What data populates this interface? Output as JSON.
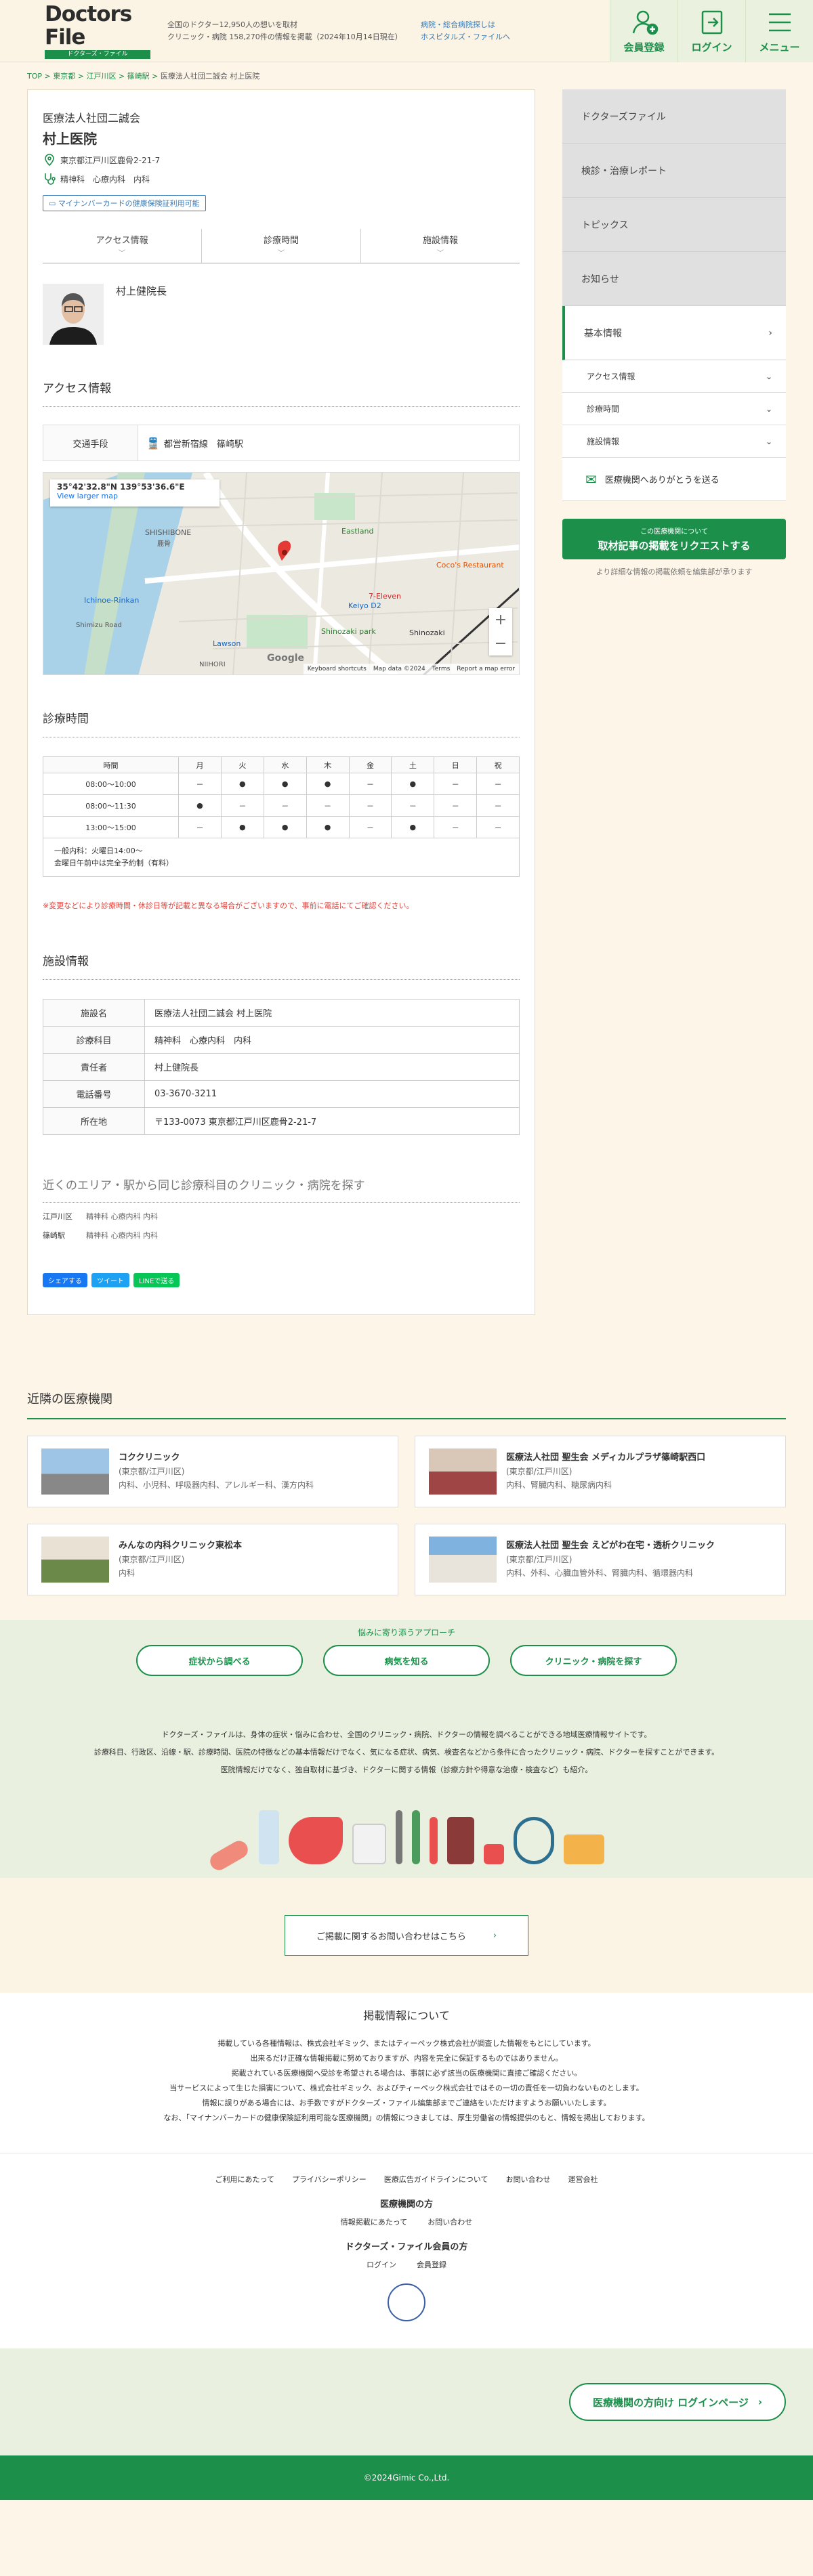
{
  "header": {
    "logo": "Doctors File",
    "logo_sub": "ドクターズ・ファイル",
    "desc1": "全国のドクター12,950人の想いを取材",
    "desc2": "クリニック・病院 158,270件の情報を掲載（2024年10月14日現在）",
    "hosp1": "病院・総合病院探しは",
    "hosp2": "ホスピタルズ・ファイルへ",
    "btn_register": "会員登録",
    "btn_login": "ログイン",
    "btn_menu": "メニュー"
  },
  "breadcrumb": [
    "TOP",
    "東京都",
    "江戸川区",
    "篠崎駅",
    "医療法人社団二誠会 村上医院"
  ],
  "clinic": {
    "corp": "医療法人社団二誠会",
    "name": "村上医院",
    "address": "東京都江戸川区鹿骨2-21-7",
    "depts": "精神科　心療内科　内科",
    "myna": "マイナンバーカードの健康保険証利用可能",
    "tabs": [
      "アクセス情報",
      "診療時間",
      "施設情報"
    ],
    "doctor": "村上健院長"
  },
  "access": {
    "title": "アクセス情報",
    "k": "交通手段",
    "v": "都営新宿線　篠崎駅",
    "map_coord": "35°42'32.8\"N 139°53'36.6\"E",
    "map_link": "View larger map",
    "map_footer": [
      "Keyboard shortcuts",
      "Map data ©2024",
      "Terms",
      "Report a map error"
    ],
    "map_labels": [
      "SHISHIBONE",
      "鹿骨",
      "Eastland",
      "Ichinoe-Rinkan",
      "Shimizu Road",
      "NIIHORI",
      "Lawson",
      "Keiyo D2",
      "7-Eleven",
      "Coco's Restaurant",
      "Shinozaki park",
      "Shinozaki",
      "Google"
    ]
  },
  "hours": {
    "title": "診療時間",
    "cols": [
      "時間",
      "月",
      "火",
      "水",
      "木",
      "金",
      "土",
      "日",
      "祝"
    ],
    "rows": [
      [
        "08:00〜10:00",
        "－",
        "●",
        "●",
        "●",
        "－",
        "●",
        "－",
        "－"
      ],
      [
        "08:00〜11:30",
        "●",
        "－",
        "－",
        "－",
        "－",
        "－",
        "－",
        "－"
      ],
      [
        "13:00〜15:00",
        "－",
        "●",
        "●",
        "●",
        "－",
        "●",
        "－",
        "－"
      ]
    ],
    "note1": "一般内科：火曜日14:00〜",
    "note2": "金曜日午前中は完全予約制（有料）",
    "warn": "※変更などにより診療時間・休診日等が記載と異なる場合がございますので、事前に電話にてご確認ください。"
  },
  "facility": {
    "title": "施設情報",
    "rows": [
      [
        "施設名",
        "医療法人社団二誠会 村上医院"
      ],
      [
        "診療科目",
        "精神科　心療内科　内科"
      ],
      [
        "責任者",
        "村上健院長"
      ],
      [
        "電話番号",
        "03-3670-3211"
      ],
      [
        "所在地",
        "〒133-0073 東京都江戸川区鹿骨2-21-7"
      ]
    ]
  },
  "near": {
    "title": "近くのエリア・駅から同じ診療科目のクリニック・病院を探す",
    "rows": [
      [
        "江戸川区",
        "精神科 心療内科 内科"
      ],
      [
        "篠崎駅",
        "精神科 心療内科 内科"
      ]
    ]
  },
  "share": [
    "シェアする",
    "ツイート",
    "LINEで送る"
  ],
  "side": {
    "nav": [
      "ドクターズファイル",
      "検診・治療レポート",
      "トピックス",
      "お知らせ",
      "基本情報"
    ],
    "sub": [
      "アクセス情報",
      "診療時間",
      "施設情報"
    ],
    "ask": "医療機関へありがとうを送る",
    "req_small": "この医療機関について",
    "req_big": "取材記事の掲載をリクエストする",
    "req_note": "より詳細な情報の掲載依頼を編集部が承ります"
  },
  "nearby": {
    "title": "近隣の医療機関",
    "cards": [
      {
        "name": "コククリニック",
        "area": "(東京都/江戸川区)",
        "depts": "内科、小児科、呼吸器内科、アレルギー科、漢方内科"
      },
      {
        "name": "医療法人社団 聖生会 メディカルプラザ篠崎駅西口",
        "area": "(東京都/江戸川区)",
        "depts": "内科、腎臓内科、糖尿病内科"
      },
      {
        "name": "みんなの内科クリニック東松本",
        "area": "(東京都/江戸川区)",
        "depts": "内科"
      },
      {
        "name": "医療法人社団 聖生会 えどがわ在宅・透析クリニック",
        "area": "(東京都/江戸川区)",
        "depts": "内科、外科、心臓血管外科、腎臓内科、循環器内科"
      }
    ]
  },
  "approach": {
    "q": "悩みに寄り添うアプローチ",
    "btns": [
      "症状から調べる",
      "病気を知る",
      "クリニック・病院を探す"
    ],
    "about1": "ドクターズ・ファイルは、身体の症状・悩みに合わせ、全国のクリニック・病院、ドクターの情報を調べることができる地域医療情報サイトです。",
    "about2": "診療科目、行政区、沿線・駅、診療時間、医院の特徴などの基本情報だけでなく、気になる症状、病気、検査名などから条件に合ったクリニック・病院、ドクターを探すことができます。",
    "about3": "医院情報だけでなく、独自取材に基づき、ドクターに関する情報（診療方針や得意な治療・検査など）も紹介。"
  },
  "inquiry": "ご掲載に関するお問い合わせはこちら",
  "publish": {
    "title": "掲載情報について",
    "lines": [
      "掲載している各種情報は、株式会社ギミック、またはティーペック株式会社が調査した情報をもとにしています。",
      "出来るだけ正確な情報掲載に努めておりますが、内容を完全に保証するものではありません。",
      "掲載されている医療機関へ受診を希望される場合は、事前に必ず該当の医療機関に直接ご確認ください。",
      "当サービスによって生じた損害について、株式会社ギミック、およびティーペック株式会社ではその一切の責任を一切負わないものとします。",
      "情報に誤りがある場合には、お手数ですがドクターズ・ファイル編集部までご連絡をいただけますようお願いいたします。",
      "なお、「マイナンバーカードの健康保険証利用可能な医療機関」の情報につきましては、厚生労働省の情報提供のもと、情報を掲出しております。"
    ]
  },
  "footer": {
    "links": [
      "ご利用にあたって",
      "プライバシーポリシー",
      "医療広告ガイドラインについて",
      "お問い合わせ",
      "運営会社"
    ],
    "med_title": "医療機関の方",
    "med_links": [
      "情報掲載にあたって",
      "お問い合わせ"
    ],
    "mem_title": "ドクターズ・ファイル会員の方",
    "mem_links": [
      "ログイン",
      "会員登録"
    ],
    "login_btn": "医療機関の方向け ログインページ",
    "copy": "©2024Gimic Co.,Ltd."
  },
  "colors": {
    "brand": "#1c8f4b",
    "bg": "#fdf5e8",
    "warn": "#e0443c"
  }
}
